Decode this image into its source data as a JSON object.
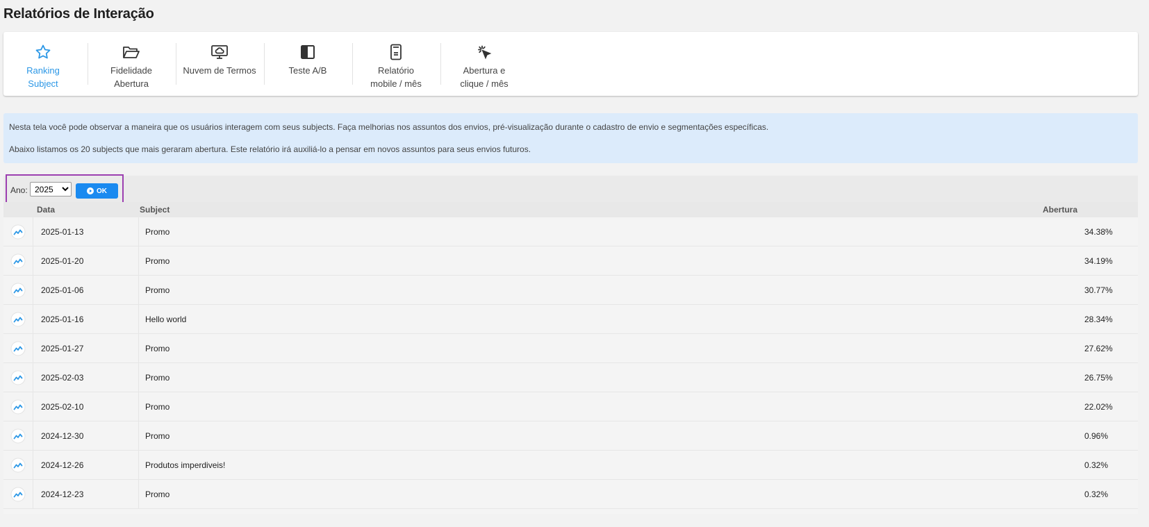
{
  "page": {
    "title": "Relatórios de Interação"
  },
  "colors": {
    "accent": "#2b97e6",
    "info_bg": "#dcebfb",
    "ok_button": "#1a8af0",
    "highlight_border": "#9c3fb0"
  },
  "tabs": [
    {
      "label": "Ranking\nSubject",
      "icon": "star-icon",
      "active": true
    },
    {
      "label": "Fidelidade\nAbertura",
      "icon": "folder-open-icon",
      "active": false
    },
    {
      "label": "Nuvem de Termos",
      "icon": "cloud-monitor-icon",
      "active": false
    },
    {
      "label": "Teste A/B",
      "icon": "split-square-icon",
      "active": false
    },
    {
      "label": "Relatório\nmobile / mês",
      "icon": "mobile-icon",
      "active": false
    },
    {
      "label": "Abertura e\nclique / mês",
      "icon": "cursor-click-icon",
      "active": false
    }
  ],
  "info": {
    "line1": "Nesta tela você pode observar a maneira que os usuários interagem com seus subjects. Faça melhorias nos assuntos dos envios, pré-visualização durante o cadastro de envio e segmentações específicas.",
    "line2": "Abaixo listamos os 20 subjects que mais geraram abertura. Este relatório irá auxiliá-lo a pensar em novos assuntos para seus envios futuros."
  },
  "filter": {
    "label": "Ano:",
    "year": "2025",
    "ok_label": "OK"
  },
  "table": {
    "headers": {
      "date": "Data",
      "subject": "Subject",
      "open": "Abertura"
    },
    "rows": [
      {
        "date": "2025-01-13",
        "subject": "Promo",
        "open": "34.38%"
      },
      {
        "date": "2025-01-20",
        "subject": "Promo",
        "open": "34.19%"
      },
      {
        "date": "2025-01-06",
        "subject": "Promo",
        "open": "30.77%"
      },
      {
        "date": "2025-01-16",
        "subject": "Hello world",
        "open": "28.34%"
      },
      {
        "date": "2025-01-27",
        "subject": "Promo",
        "open": "27.62%"
      },
      {
        "date": "2025-02-03",
        "subject": "Promo",
        "open": "26.75%"
      },
      {
        "date": "2025-02-10",
        "subject": "Promo",
        "open": "22.02%"
      },
      {
        "date": "2024-12-30",
        "subject": "Promo",
        "open": "0.96%"
      },
      {
        "date": "2024-12-26",
        "subject": "Produtos imperdiveis!",
        "open": "0.32%"
      },
      {
        "date": "2024-12-23",
        "subject": "Promo",
        "open": "0.32%"
      }
    ]
  }
}
